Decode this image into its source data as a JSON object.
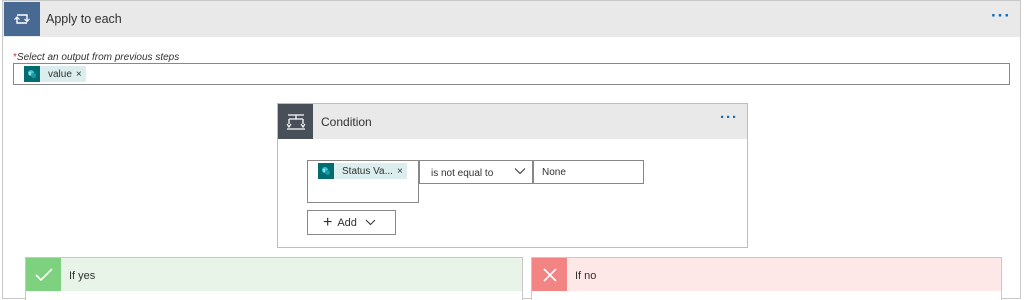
{
  "apply_to_each": {
    "title": "Apply to each",
    "more_label": "···",
    "output_label": "Select an output from previous steps",
    "required_mark": "*",
    "output_token": {
      "label": "value",
      "remove": "×",
      "icon": "sharepoint-icon"
    }
  },
  "condition": {
    "title": "Condition",
    "more_label": "···",
    "left_operand_token": {
      "label": "Status Va...",
      "remove": "×",
      "icon": "sharepoint-icon"
    },
    "operator": "is not equal to",
    "right_operand": "None",
    "add_button": {
      "plus": "+",
      "label": "Add"
    }
  },
  "branches": {
    "yes": {
      "title": "If yes",
      "color": "#7ed17f",
      "header_color": "#e8f4e8"
    },
    "no": {
      "title": "If no",
      "color": "#f28484",
      "header_color": "#fde7e7"
    }
  },
  "colors": {
    "loop_badge": "#486991",
    "condition_badge": "#484f58",
    "accent": "#0a6ebd",
    "token_icon": "#036c70",
    "token_bg": "#dbeeed"
  }
}
